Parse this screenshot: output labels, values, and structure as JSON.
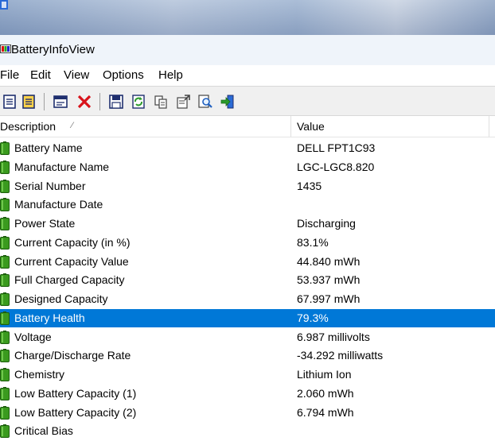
{
  "window": {
    "title": "BatteryInfoView"
  },
  "menu": [
    "File",
    "Edit",
    "View",
    "Options",
    "Help"
  ],
  "columns": {
    "description": "Description",
    "value": "Value"
  },
  "rows": [
    {
      "description": "Battery Name",
      "value": "DELL FPT1C93"
    },
    {
      "description": "Manufacture Name",
      "value": "LGC-LGC8.820"
    },
    {
      "description": "Serial Number",
      "value": "1435"
    },
    {
      "description": "Manufacture Date",
      "value": ""
    },
    {
      "description": "Power State",
      "value": "Discharging"
    },
    {
      "description": "Current Capacity (in %)",
      "value": "83.1%"
    },
    {
      "description": "Current Capacity Value",
      "value": "44.840 mWh"
    },
    {
      "description": "Full Charged Capacity",
      "value": "53.937 mWh"
    },
    {
      "description": "Designed Capacity",
      "value": "67.997 mWh"
    },
    {
      "description": "Battery Health",
      "value": "79.3%"
    },
    {
      "description": "Voltage",
      "value": "6.987 millivolts"
    },
    {
      "description": "Charge/Discharge Rate",
      "value": "-34.292 milliwatts"
    },
    {
      "description": "Chemistry",
      "value": "Lithium Ion"
    },
    {
      "description": "Low Battery Capacity (1)",
      "value": "2.060 mWh"
    },
    {
      "description": "Low Battery Capacity (2)",
      "value": "6.794 mWh"
    },
    {
      "description": "Critical Bias",
      "value": ""
    }
  ],
  "selected_row": "Battery Health",
  "colors": {
    "selection": "#0078d7",
    "battery_green": "#3a9a1e",
    "titlebar": "#eff4fa",
    "toolbar": "#f0f0f0"
  },
  "toolbar_icons": [
    "html-report-all-icon",
    "html-report-selected-icon",
    "properties-window-icon",
    "delete-icon",
    "save-icon",
    "refresh-icon",
    "copy-icon",
    "properties-icon",
    "find-icon",
    "exit-icon"
  ]
}
